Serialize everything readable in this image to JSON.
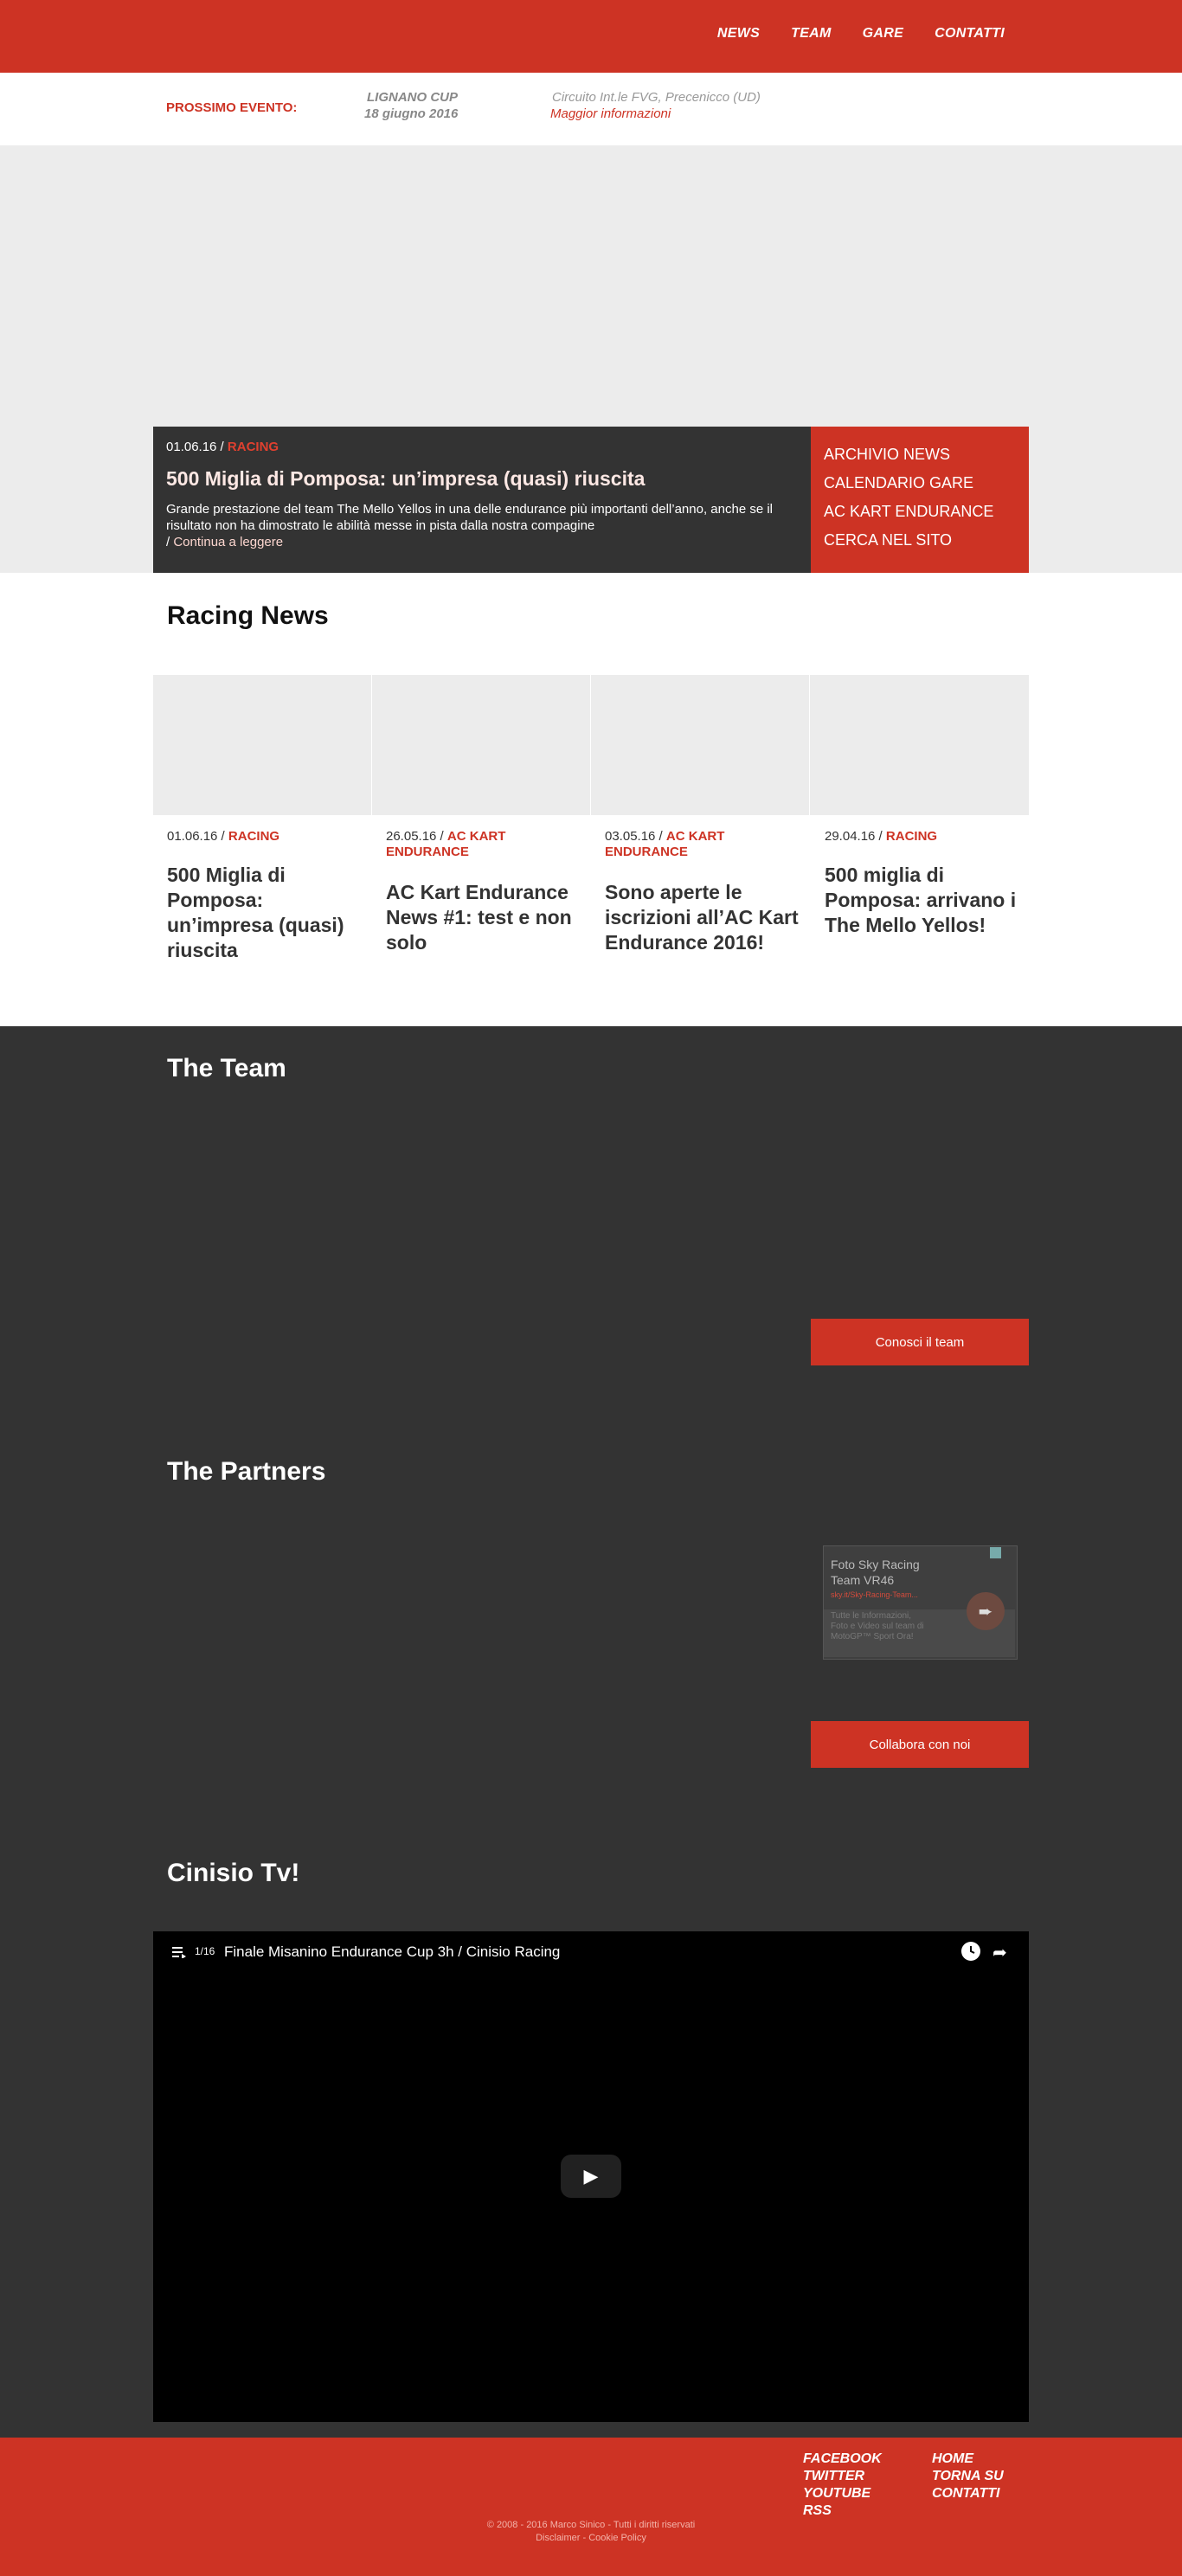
{
  "nav": {
    "items": [
      "NEWS",
      "TEAM",
      "GARE",
      "CONTATTI"
    ]
  },
  "event": {
    "label": "PROSSIMO EVENTO:",
    "name": "LIGNANO CUP",
    "date": "18 giugno 2016",
    "place": "Circuito Int.le FVG, Precenicco (UD)",
    "more": "Maggior informazioni"
  },
  "hero": {
    "date": "01.06.16 / ",
    "category": "RACING",
    "title": "500 Miglia di Pomposa: un’impresa (quasi) riuscita",
    "text": "Grande prestazione del team The Mello Yellos in una delle endurance più importanti dell’anno, anche se il risultato non ha dimostrato le abilità messe in pista dalla nostra compagine",
    "read_more": "Continua a leggere",
    "side_links": [
      "ARCHIVIO NEWS",
      "CALENDARIO GARE",
      "AC KART ENDURANCE",
      "CERCA NEL SITO"
    ]
  },
  "racing_news": {
    "title": "Racing News",
    "cards": [
      {
        "date": "01.06.16 / ",
        "category": "RACING",
        "title": "500 Miglia di Pomposa: un’impresa (quasi) riuscita"
      },
      {
        "date": "26.05.16 / ",
        "category": "AC KART ENDURANCE",
        "title": "AC Kart Endurance News #1: test e non solo"
      },
      {
        "date": "03.05.16 / ",
        "category": "AC KART ENDURANCE",
        "title": "Sono aperte le iscrizioni all’AC Kart Endurance 2016!"
      },
      {
        "date": "29.04.16 / ",
        "category": "RACING",
        "title": "500 miglia di Pomposa: arrivano i The Mello Yellos!"
      }
    ]
  },
  "team": {
    "title": "The Team",
    "button": "Conosci il team"
  },
  "partners": {
    "title": "The Partners",
    "button": "Collabora con noi",
    "ad": {
      "title": "Foto Sky Racing Team VR46",
      "url": "sky.it/Sky-Racing-Team...",
      "text": "Tutte le Informazioni, Foto e Video sul team di MotoGP™ Sport Ora!"
    }
  },
  "tv": {
    "title": "Cinisio Tv!",
    "video_count": "1/16",
    "video_title": "Finale Misanino Endurance Cup 3h / Cinisio Racing"
  },
  "footer": {
    "col1": [
      "FACEBOOK",
      "TWITTER",
      "YOUTUBE",
      "RSS"
    ],
    "col2": [
      "HOME",
      "TORNA SU",
      "CONTATTI"
    ],
    "copyright": "© 2008 - 2016 Marco Sinico - Tutti i diritti riservati",
    "legal": "Disclaimer - Cookie Policy"
  },
  "colors": {
    "brand_red": "#cd3324",
    "dark_bg": "#333333",
    "light_grey": "#ececec"
  }
}
